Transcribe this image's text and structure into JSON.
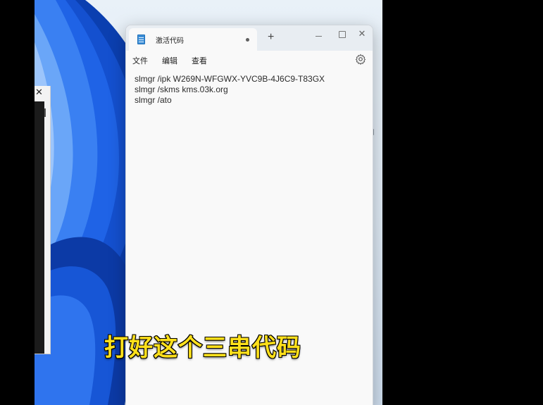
{
  "background_window": {
    "close_glyph": "✕"
  },
  "notepad": {
    "tab_title": "激活代码",
    "new_tab_glyph": "+",
    "window_controls": {
      "minimize": "—",
      "maximize": "□",
      "close": "✕"
    },
    "menu": {
      "file": "文件",
      "edit": "编辑",
      "view": "查看"
    },
    "settings_icon": "gear-icon",
    "content_lines": [
      "slmgr /ipk W269N-WFGWX-YVC9B-4J6C9-T83GX",
      "slmgr /skms kms.03k.org",
      "slmgr /ato"
    ]
  },
  "subtitle": "打好这个三串代码",
  "colors": {
    "wallpaper_blue": "#1a5ed8",
    "subtitle_yellow": "#ffe01b",
    "notepad_icon": "#3d8fd8"
  }
}
